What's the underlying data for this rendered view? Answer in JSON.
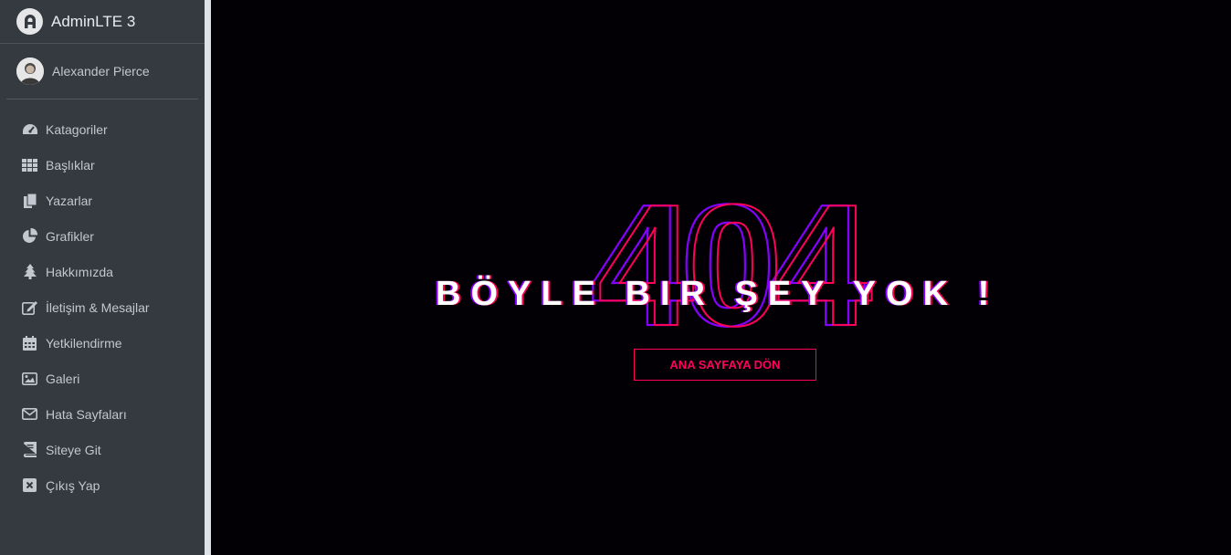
{
  "brand": {
    "title": "AdminLTE 3",
    "logo_icon": "adminlte-logo-icon"
  },
  "user": {
    "name": "Alexander Pierce"
  },
  "sidebar": {
    "items": [
      {
        "label": "Katagoriler",
        "icon": "dashboard-gauge-icon"
      },
      {
        "label": "Başlıklar",
        "icon": "grid-table-icon"
      },
      {
        "label": "Yazarlar",
        "icon": "copy-pages-icon"
      },
      {
        "label": "Grafikler",
        "icon": "pie-chart-icon"
      },
      {
        "label": "Hakkımızda",
        "icon": "tree-icon"
      },
      {
        "label": "İletişim & Mesajlar",
        "icon": "edit-icon"
      },
      {
        "label": "Yetkilendirme",
        "icon": "calendar-icon"
      },
      {
        "label": "Galeri",
        "icon": "image-icon"
      },
      {
        "label": "Hata Sayfaları",
        "icon": "envelope-icon"
      },
      {
        "label": "Siteye Git",
        "icon": "book-icon"
      },
      {
        "label": "Çıkış Yap",
        "icon": "close-square-icon"
      }
    ]
  },
  "error": {
    "code": "404",
    "message": "BÖYLE BIR ŞEY YOK !",
    "button_label": "ANA SAYFAYA DÖN"
  },
  "colors": {
    "sidebar_bg": "#343a40",
    "page_bg": "#030005",
    "accent_pink": "#ff005a",
    "accent_purple": "#8400ff"
  }
}
